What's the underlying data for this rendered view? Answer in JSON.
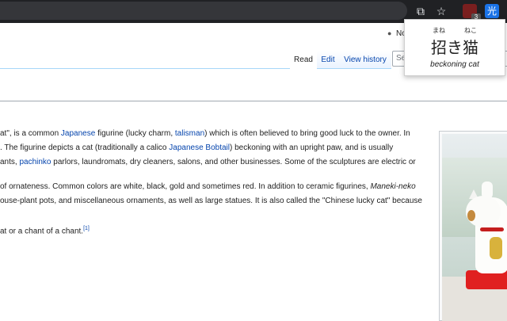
{
  "browser": {
    "extensions": {
      "red_badge": "3",
      "blue_label": "光"
    }
  },
  "popup": {
    "ruby_left": "まね",
    "ruby_right": "ねこ",
    "word": "招き猫",
    "meaning": "beckoning cat"
  },
  "header": {
    "user_text": "No",
    "tabs": {
      "read": "Read",
      "edit": "Edit",
      "history": "View history"
    },
    "search_placeholder": "Se"
  },
  "article": {
    "p1": {
      "l1_a": "at\", is a common ",
      "l1_link1": "Japanese",
      "l1_b": " figurine (lucky charm, ",
      "l1_link2": "talisman",
      "l1_c": ") which is often believed to bring good luck to the owner. In",
      "l2_a": ". The figurine depicts a cat (traditionally a calico ",
      "l2_link": "Japanese Bobtail",
      "l2_b": ") beckoning with an upright paw, and is usually",
      "l3_a": "ants, ",
      "l3_link": "pachinko",
      "l3_b": " parlors, laundromats, dry cleaners, salons, and other businesses. Some of the sculptures are electric or"
    },
    "p2": {
      "l1_a": "of ornateness. Common colors are white, black, gold and sometimes red. In addition to ceramic figurines, ",
      "l1_em": "Maneki-neko",
      "l2": "ouse-plant pots, and miscellaneous ornaments, as well as large statues. It is also called the \"Chinese lucky cat\" because"
    },
    "p3": {
      "text": "at or a chant of a chant.",
      "ref": "[1]"
    }
  }
}
